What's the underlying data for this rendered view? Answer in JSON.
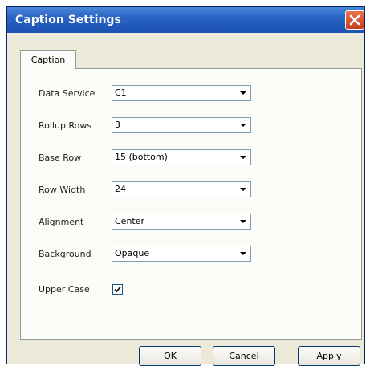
{
  "window": {
    "title": "Caption Settings"
  },
  "tabs": [
    {
      "label": "Caption"
    }
  ],
  "fields": [
    {
      "label": "Data Service",
      "value": "C1"
    },
    {
      "label": "Rollup Rows",
      "value": "3"
    },
    {
      "label": "Base Row",
      "value": "15 (bottom)"
    },
    {
      "label": "Row Width",
      "value": "24"
    },
    {
      "label": "Alignment",
      "value": "Center"
    },
    {
      "label": "Background",
      "value": "Opaque"
    }
  ],
  "upper_case": {
    "label": "Upper Case",
    "checked": true
  },
  "buttons": {
    "ok": "OK",
    "cancel": "Cancel",
    "apply": "Apply"
  },
  "icons": {
    "close": "close-icon",
    "dropdown": "chevron-down-icon",
    "check": "checkmark-icon"
  },
  "colors": {
    "titlebar": "#2a64c4",
    "close": "#d9532c",
    "dialog_bg": "#ece9d8"
  }
}
